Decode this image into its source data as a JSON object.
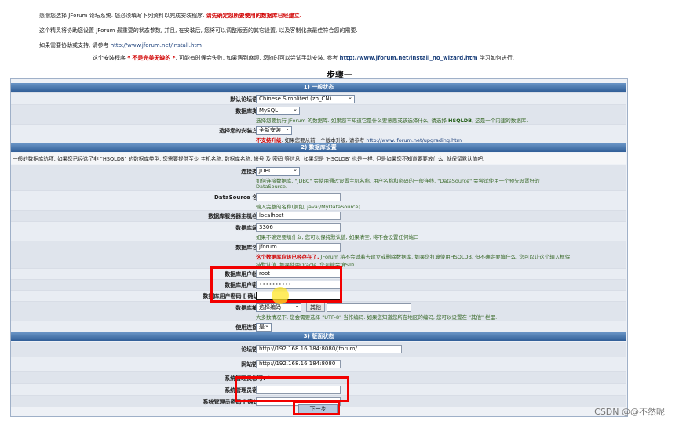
{
  "intro": {
    "line1_a": "感谢您选择 JForum 论坛系统. 您必须填写下列资料以完成安装程序. ",
    "line1_b": "请先确定您所要使用的数据库已经建立.",
    "line2": "这个精灵将协助您设置 JForum 最重要的状态参数, 并且, 在安装后, 您将可以调整版面的其它设置, 以及客制化来最佳符合您的需要.",
    "line3_a": "如果需要协助或支持, 请参考 ",
    "line3_link": "http://www.jforum.net/install.htm",
    "line4_a": "这个安装程序 ",
    "line4_red": "* 不是完美无缺的 *",
    "line4_b": ", 可能有时候会失败. 如果遇到麻烦, 您随时可以尝试手动安装. 参考 ",
    "line4_link": "http://www.jforum.net/install_no_wizard.htm",
    "line4_c": " 学习如何进行."
  },
  "step_title": "步骤一",
  "sections": {
    "s1": "1) 一般状态",
    "s2": "2) 数据库设置",
    "s3": "3) 版面状态"
  },
  "general": {
    "lang_label": "默认论坛语言:",
    "lang_value": "Chinese Simplifed (zh_CN)",
    "dbtype_label": "数据库类型:",
    "dbtype_value": "MySQL",
    "dbtype_hint_a": "选择您要执行 JForum 的数据库. 如果您不知道它是什么要意思或该选择什么, 请选择 ",
    "dbtype_hint_b": "HSQLDB",
    "dbtype_hint_c": ", 这是一个内建的数据库.",
    "install_label": "选择您的安装方式:",
    "install_value": "全新安装",
    "install_hint_red": "不支持升级",
    "install_hint_b": ". 如果您要从前一个版本升级, 请参考 ",
    "install_hint_link": "http://www.jforum.net/upgrading.htm"
  },
  "db": {
    "desc": "一般的数据库选项. 如果您已经选了非 \"HSQLDB\" 的数据库类型, 您需要提供至少 主机名称, 数据库名称, 帐号 及 密码 等信息. 如果您是 'HSQLDB' 也是一样, 但是如果您不知道要要放什么, 就保留默认值吧.",
    "conn_label": "连接类型:",
    "conn_value": "JDBC",
    "conn_hint1": "如何连接数据库. \"JDBC\" 会使用通过设置主机名称, 用户名称和密码的一般连线. \"DataSource\" 会尝试使用一个预先设置好的",
    "conn_hint2": "DataSource.",
    "ds_label": "DataSource 名称:",
    "ds_hint": "输入完整的名称(例如, java:/MyDataSource)",
    "host_label": "数据库服务器主机名称:",
    "host_value": "localhost",
    "port_label": "数据库端口:",
    "port_value": "3306",
    "port_hint": "如果不确定要填什么, 您可以保持默认值, 如果清空, 将不会设置任何端口",
    "name_label": "数据库名称:",
    "name_value": "jforum",
    "name_hint_red": "这个数据库应该已经存在了.",
    "name_hint_b": " JForum 将不会试着去建立或删除数据库. 如果您打算使用HSQLDB, 但不确定要填什么, 您可以让这个输入框保",
    "name_hint_c": "持默认值. 如果使用Oracle, 您可能会填SID.",
    "user_label": "数据库用户帐号:",
    "user_value": "root",
    "pass_label": "数据库用户密码:",
    "pass_value": "••••••••••",
    "pass2_label": "数据库用户密码 [ 确认 ]:",
    "pass2_value": "",
    "enc_label": "数据库编码:",
    "enc_value": "选择编码",
    "enc_other": "其他",
    "enc_hint": "大多数情况下, 您会需要选择 \"UTF-8\" 当作编码. 如果您知道您所在地区的编码, 您可以设置在 \"其他\" 栏里.",
    "pool_label": "使用连接池:",
    "pool_value": "是"
  },
  "forum": {
    "link_label": "论坛链接:",
    "link_value": "http://192.168.16.184:8080/jforum/",
    "site_label": "网站链接:",
    "site_value": "http://192.168.16.184:8080",
    "admin_label": "系统管理员帐号:",
    "admin_value": "Admin",
    "apass_label": "系统管理员密码:",
    "apass2_label": "系统管理员密码 [ 确认 ]:"
  },
  "next_button": "下一步",
  "watermark": "CSDN @@不然呢",
  "colors": {
    "highlight": "#f20000",
    "section": "#315f98",
    "cursor": "#ffe628"
  }
}
